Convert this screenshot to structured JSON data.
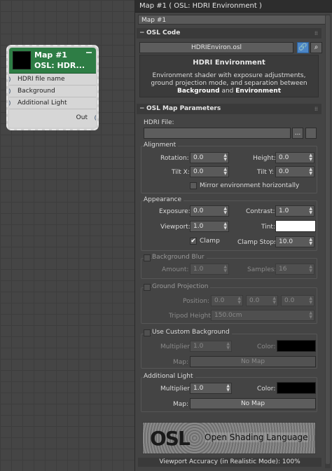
{
  "node": {
    "title": "Map #1",
    "subtitle": "OSL:  HDR...",
    "inputs": [
      "HDRI file name",
      "Background",
      "Additional Light"
    ],
    "output": "Out"
  },
  "panel": {
    "title": "Map #1    ( OSL: HDRI Environment )",
    "name_field": "Map #1",
    "osl_code": {
      "header": "OSL Code",
      "file": "HDRIEnviron.osl",
      "desc_title": "HDRI Environment",
      "desc_line1": "Environment shader with exposure adjustments,",
      "desc_line2": "ground projection mode, and separation between",
      "desc_bold1": "Background",
      "desc_and": "and",
      "desc_bold2": "Environment"
    },
    "params_header": "OSL Map Parameters",
    "hdri_file_label": "HDRI File:",
    "hdri_file_button": "",
    "ellipsis": "...",
    "alignment": {
      "title": "Alignment",
      "rotation_label": "Rotation:",
      "rotation": "0.0",
      "height_label": "Height:",
      "height": "0.0",
      "tiltx_label": "Tilt X:",
      "tiltx": "0.0",
      "tilty_label": "Tilt Y:",
      "tilty": "0.0",
      "mirror_label": "Mirror environment horizontally",
      "mirror_checked": false
    },
    "appearance": {
      "title": "Appearance",
      "exposure_label": "Exposure:",
      "exposure": "0.0",
      "contrast_label": "Contrast:",
      "contrast": "1.0",
      "viewport_label": "Viewport:",
      "viewport": "1.0",
      "tint_label": "Tint:",
      "tint_color": "#ffffff",
      "clamp_label": "Clamp",
      "clamp_checked": true,
      "clampstops_label": "Clamp Stops:",
      "clampstops": "10.0"
    },
    "background_blur": {
      "title": "Background Blur",
      "amount_label": "Amount:",
      "amount": "1.0",
      "samples_label": "Samples:",
      "samples": "16"
    },
    "ground_projection": {
      "title": "Ground Projection",
      "position_label": "Position:",
      "pos_x": "0.0",
      "pos_y": "0.0",
      "pos_z": "0.0",
      "tripod_label": "Tripod Height:",
      "tripod": "150.0cm"
    },
    "custom_background": {
      "title": "Use Custom Background",
      "multiplier_label": "Multiplier:",
      "multiplier": "1.0",
      "color_label": "Color:",
      "color": "#000000",
      "map_label": "Map:",
      "map": "No Map"
    },
    "additional_light": {
      "title": "Additional Light",
      "multiplier_label": "Multiplier:",
      "multiplier": "1.0",
      "color_label": "Color:",
      "color": "#000000",
      "map_label": "Map:",
      "map": "No Map"
    },
    "logo_osl": "OSL",
    "logo_text": "Open Shading Language",
    "footer": "Viewport Accuracy (in Realistic Mode): 100%"
  }
}
